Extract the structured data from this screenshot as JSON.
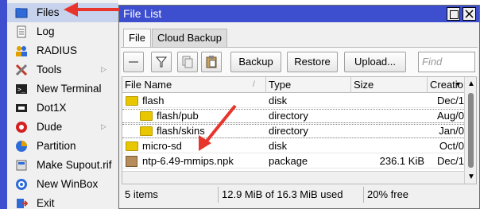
{
  "sidebar": {
    "items": [
      {
        "label": "Files",
        "icon": "folder-icon",
        "active": true
      },
      {
        "label": "Log",
        "icon": "notepad-icon"
      },
      {
        "label": "RADIUS",
        "icon": "users-icon"
      },
      {
        "label": "Tools",
        "icon": "tools-icon",
        "submenu": true
      },
      {
        "label": "New Terminal",
        "icon": "terminal-icon"
      },
      {
        "label": "Dot1X",
        "icon": "dot1x-icon"
      },
      {
        "label": "Dude",
        "icon": "dude-icon",
        "submenu": true
      },
      {
        "label": "Partition",
        "icon": "partition-icon"
      },
      {
        "label": "Make Supout.rif",
        "icon": "supout-icon"
      },
      {
        "label": "New WinBox",
        "icon": "winbox-icon"
      },
      {
        "label": "Exit",
        "icon": "exit-icon"
      }
    ]
  },
  "window": {
    "title": "File List",
    "tabs": [
      "File",
      "Cloud Backup"
    ],
    "toolbar": {
      "remove_icon": "minus-icon",
      "filter_icon": "filter-icon",
      "copy_icon": "copy-icon",
      "paste_icon": "paste-icon",
      "backup_label": "Backup",
      "restore_label": "Restore",
      "upload_label": "Upload...",
      "find_placeholder": "Find"
    },
    "table": {
      "columns": [
        "File Name",
        "Type",
        "Size",
        "Creatio"
      ],
      "rows": [
        {
          "name": "flash",
          "type": "disk",
          "size": "",
          "created": "Dec/1",
          "icon": "folder",
          "indent": 0
        },
        {
          "name": "flash/pub",
          "type": "directory",
          "size": "",
          "created": "Aug/0",
          "icon": "folder",
          "indent": 1
        },
        {
          "name": "flash/skins",
          "type": "directory",
          "size": "",
          "created": "Jan/0",
          "icon": "folder",
          "indent": 1
        },
        {
          "name": "micro-sd",
          "type": "disk",
          "size": "",
          "created": "Oct/0",
          "icon": "folder",
          "indent": 0
        },
        {
          "name": "ntp-6.49-mmips.npk",
          "type": "package",
          "size": "236.1 KiB",
          "created": "Dec/1",
          "icon": "package",
          "indent": 0
        }
      ]
    },
    "status": {
      "items": "5 items",
      "used": "12.9 MiB of 16.3 MiB used",
      "free": "20% free"
    }
  },
  "colors": {
    "title_bar": "#3d4fcf",
    "annotation_arrow": "#e8352b",
    "folder": "#e8c700"
  }
}
